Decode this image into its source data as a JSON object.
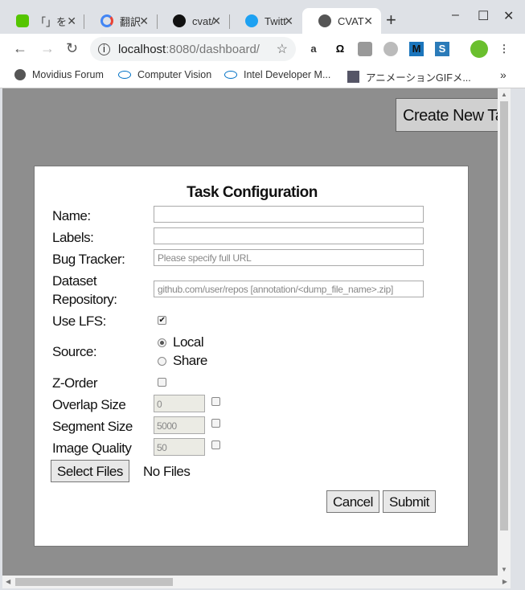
{
  "tabs": [
    {
      "title": "「」を",
      "icon": "qiita-icon",
      "color": "#55c500"
    },
    {
      "title": "翻訳",
      "icon": "google-icon",
      "color": "#4285f4"
    },
    {
      "title": "cvat/",
      "icon": "github-icon",
      "color": "#111"
    },
    {
      "title": "Twitt",
      "icon": "twitter-icon",
      "color": "#1da1f2"
    },
    {
      "title": "CVAT",
      "icon": "globe-icon",
      "color": "#555"
    }
  ],
  "address": {
    "host": "localhost",
    "rest": ":8080/dashboard/"
  },
  "bookmarks": [
    "Movidius Forum",
    "Computer Vision",
    "Intel Developer M...",
    "アニメーションGIFメ..."
  ],
  "page": {
    "create_button": "Create New Task"
  },
  "form": {
    "title": "Task Configuration",
    "name_label": "Name:",
    "name_value": "",
    "labels_label": "Labels:",
    "labels_value": "",
    "bug_label": "Bug Tracker:",
    "bug_placeholder": "Please specify full URL",
    "dataset_label1": "Dataset",
    "dataset_label2": "Repository:",
    "dataset_placeholder": "github.com/user/repos [annotation/<dump_file_name>.zip]",
    "lfs_label": "Use LFS:",
    "lfs_checked": true,
    "source_label": "Source:",
    "source_local": "Local",
    "source_share": "Share",
    "source_selected": "Local",
    "zorder_label": "Z-Order",
    "zorder_checked": false,
    "overlap_label": "Overlap Size",
    "overlap_value": "0",
    "segment_label": "Segment Size",
    "segment_value": "5000",
    "quality_label": "Image Quality",
    "quality_value": "50",
    "select_files": "Select Files",
    "files_status": "No Files",
    "cancel": "Cancel",
    "submit": "Submit"
  }
}
